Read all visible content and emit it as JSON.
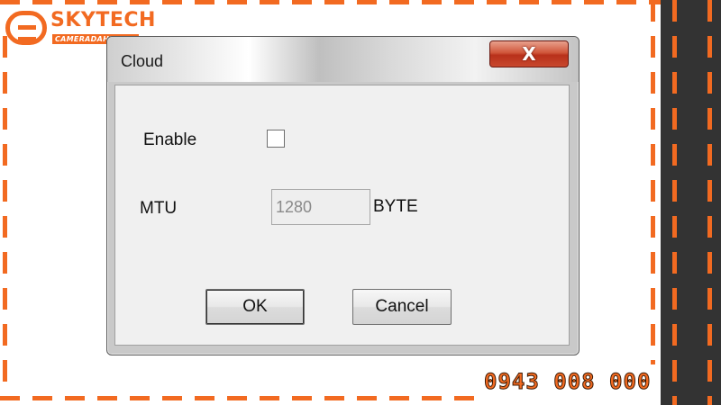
{
  "brand": {
    "logo_text": "SKYTECH",
    "logo_sub": "CAMERADAHUA.VN",
    "phone": "0943 008 000",
    "accent_color": "#f26a21"
  },
  "dialog": {
    "title": "Cloud",
    "close_icon": "close-icon",
    "close_glyph": "X",
    "enable_label": "Enable",
    "enable_checked": false,
    "mtu_label": "MTU",
    "mtu_value": "1280",
    "mtu_unit": "BYTE",
    "ok_label": "OK",
    "cancel_label": "Cancel"
  }
}
